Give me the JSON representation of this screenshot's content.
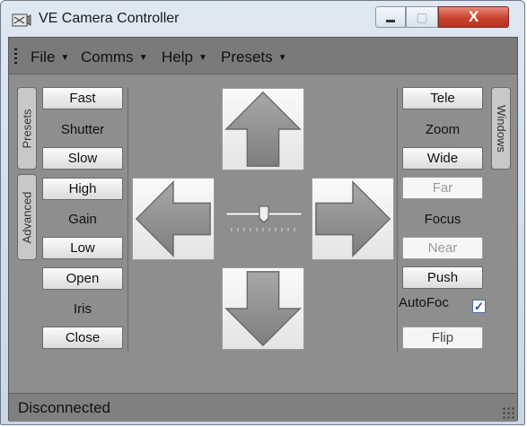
{
  "window": {
    "title": "VE Camera Controller",
    "minimize_glyph": "▬",
    "maximize_glyph": "▢",
    "close_glyph": "X"
  },
  "menu": [
    {
      "label": "File",
      "caret": "▼"
    },
    {
      "label": "Comms",
      "caret": "▼"
    },
    {
      "label": "Help",
      "caret": "▼"
    },
    {
      "label": "Presets",
      "caret": "▼"
    }
  ],
  "left_tabs": {
    "presets": "Presets",
    "advanced": "Advanced"
  },
  "right_tabs": {
    "windows": "Windows"
  },
  "left_controls": {
    "fast": "Fast",
    "shutter": "Shutter",
    "slow": "Slow",
    "high": "High",
    "gain": "Gain",
    "low": "Low",
    "open": "Open",
    "iris": "Iris",
    "close": "Close"
  },
  "right_controls": {
    "tele": "Tele",
    "zoom": "Zoom",
    "wide": "Wide",
    "far": "Far",
    "focus": "Focus",
    "near": "Near",
    "push": "Push",
    "autofocus": "AutoFoc",
    "autofocus_checked": "✓",
    "flip": "Flip"
  },
  "speed_slider": {
    "value": 0.5
  },
  "status": "Disconnected",
  "colors": {
    "close_button": "#c7432e",
    "panel_background": "#8e8e8e",
    "checkbox_border": "#4f6f9a"
  },
  "icons": [
    "app-icon",
    "up-arrow-icon",
    "down-arrow-icon",
    "left-arrow-icon",
    "right-arrow-icon",
    "menu-caret-icon",
    "resize-grip-icon"
  ]
}
